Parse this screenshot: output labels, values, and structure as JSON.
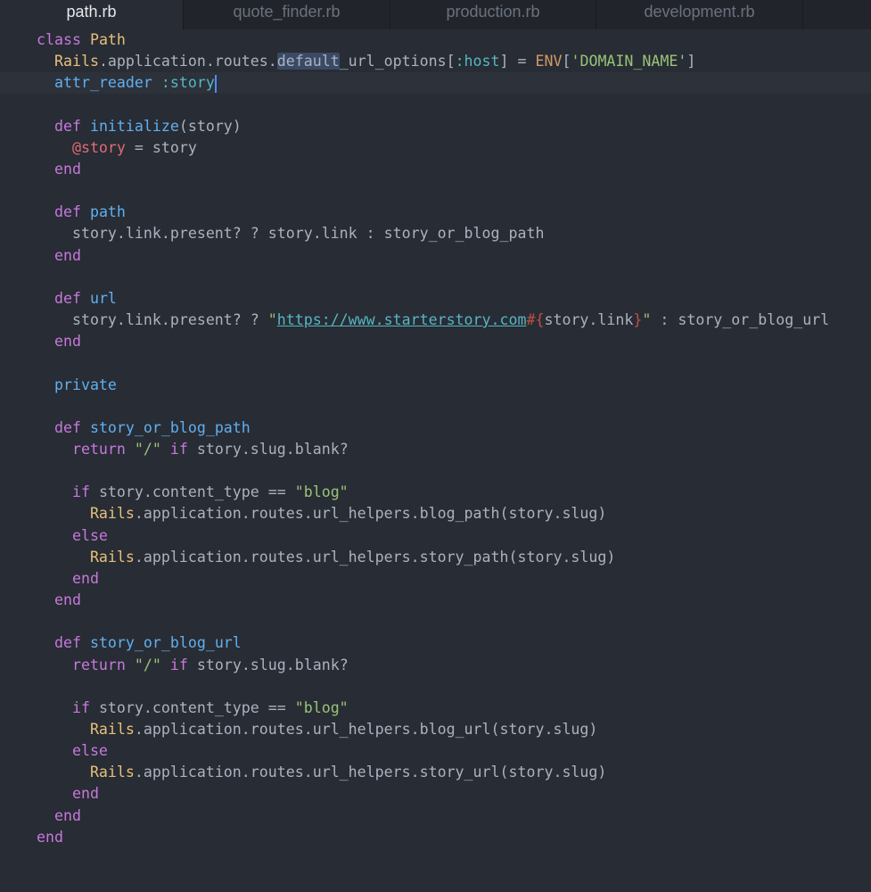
{
  "tabs": [
    {
      "label": "path.rb",
      "active": true
    },
    {
      "label": "quote_finder.rb",
      "active": false
    },
    {
      "label": "production.rb",
      "active": false
    },
    {
      "label": "development.rb",
      "active": false
    }
  ],
  "colors": {
    "background": "#282c34",
    "keyword": "#c678dd",
    "class": "#e5c07b",
    "function": "#61afef",
    "string": "#98c379",
    "variable": "#e06c75",
    "constant": "#d19a66",
    "symbol": "#56b6c2"
  },
  "code": {
    "cursor_line": 2,
    "lines": [
      [
        [
          "kw",
          "class "
        ],
        [
          "cls",
          "Path"
        ]
      ],
      [
        [
          "cls",
          "  Rails"
        ],
        [
          "plain",
          ".application.routes."
        ],
        [
          "sel",
          "default"
        ],
        [
          "plain",
          "_url_options["
        ],
        [
          "sym",
          ":host"
        ],
        [
          "plain",
          "] = "
        ],
        [
          "const",
          "ENV"
        ],
        [
          "plain",
          "["
        ],
        [
          "str",
          "'DOMAIN_NAME'"
        ],
        [
          "plain",
          "]"
        ]
      ],
      [
        [
          "fn",
          "  attr_reader "
        ],
        [
          "sym",
          ":story"
        ],
        [
          "cursor",
          ""
        ]
      ],
      [],
      [
        [
          "kw",
          "  def "
        ],
        [
          "fn",
          "initialize"
        ],
        [
          "plain",
          "(story)"
        ]
      ],
      [
        [
          "var",
          "    @story"
        ],
        [
          "plain",
          " = story"
        ]
      ],
      [
        [
          "kw",
          "  end"
        ]
      ],
      [],
      [
        [
          "kw",
          "  def "
        ],
        [
          "fn",
          "path"
        ]
      ],
      [
        [
          "plain",
          "    story.link.present? ? story.link : story_or_blog_path"
        ]
      ],
      [
        [
          "kw",
          "  end"
        ]
      ],
      [],
      [
        [
          "kw",
          "  def "
        ],
        [
          "fn",
          "url"
        ]
      ],
      [
        [
          "plain",
          "    story.link.present? ? "
        ],
        [
          "str",
          "\""
        ],
        [
          "link",
          "https://www.starterstory.com"
        ],
        [
          "interp",
          "#{"
        ],
        [
          "plain",
          "story.link"
        ],
        [
          "interp",
          "}"
        ],
        [
          "str",
          "\""
        ],
        [
          "plain",
          " : story_or_blog_url"
        ]
      ],
      [
        [
          "kw",
          "  end"
        ]
      ],
      [],
      [
        [
          "fn",
          "  private"
        ]
      ],
      [],
      [
        [
          "kw",
          "  def "
        ],
        [
          "fn",
          "story_or_blog_path"
        ]
      ],
      [
        [
          "kw",
          "    return "
        ],
        [
          "str",
          "\"/\""
        ],
        [
          "kw",
          " if"
        ],
        [
          "plain",
          " story.slug.blank?"
        ]
      ],
      [],
      [
        [
          "kw",
          "    if"
        ],
        [
          "plain",
          " story.content_type == "
        ],
        [
          "str",
          "\"blog\""
        ]
      ],
      [
        [
          "cls",
          "      Rails"
        ],
        [
          "plain",
          ".application.routes.url_helpers.blog_path(story.slug)"
        ]
      ],
      [
        [
          "kw",
          "    else"
        ]
      ],
      [
        [
          "cls",
          "      Rails"
        ],
        [
          "plain",
          ".application.routes.url_helpers.story_path(story.slug)"
        ]
      ],
      [
        [
          "kw",
          "    end"
        ]
      ],
      [
        [
          "kw",
          "  end"
        ]
      ],
      [],
      [
        [
          "kw",
          "  def "
        ],
        [
          "fn",
          "story_or_blog_url"
        ]
      ],
      [
        [
          "kw",
          "    return "
        ],
        [
          "str",
          "\"/\""
        ],
        [
          "kw",
          " if"
        ],
        [
          "plain",
          " story.slug.blank?"
        ]
      ],
      [],
      [
        [
          "kw",
          "    if"
        ],
        [
          "plain",
          " story.content_type == "
        ],
        [
          "str",
          "\"blog\""
        ]
      ],
      [
        [
          "cls",
          "      Rails"
        ],
        [
          "plain",
          ".application.routes.url_helpers.blog_url(story.slug)"
        ]
      ],
      [
        [
          "kw",
          "    else"
        ]
      ],
      [
        [
          "cls",
          "      Rails"
        ],
        [
          "plain",
          ".application.routes.url_helpers.story_url(story.slug)"
        ]
      ],
      [
        [
          "kw",
          "    end"
        ]
      ],
      [
        [
          "kw",
          "  end"
        ]
      ],
      [
        [
          "kw",
          "end"
        ]
      ]
    ]
  }
}
